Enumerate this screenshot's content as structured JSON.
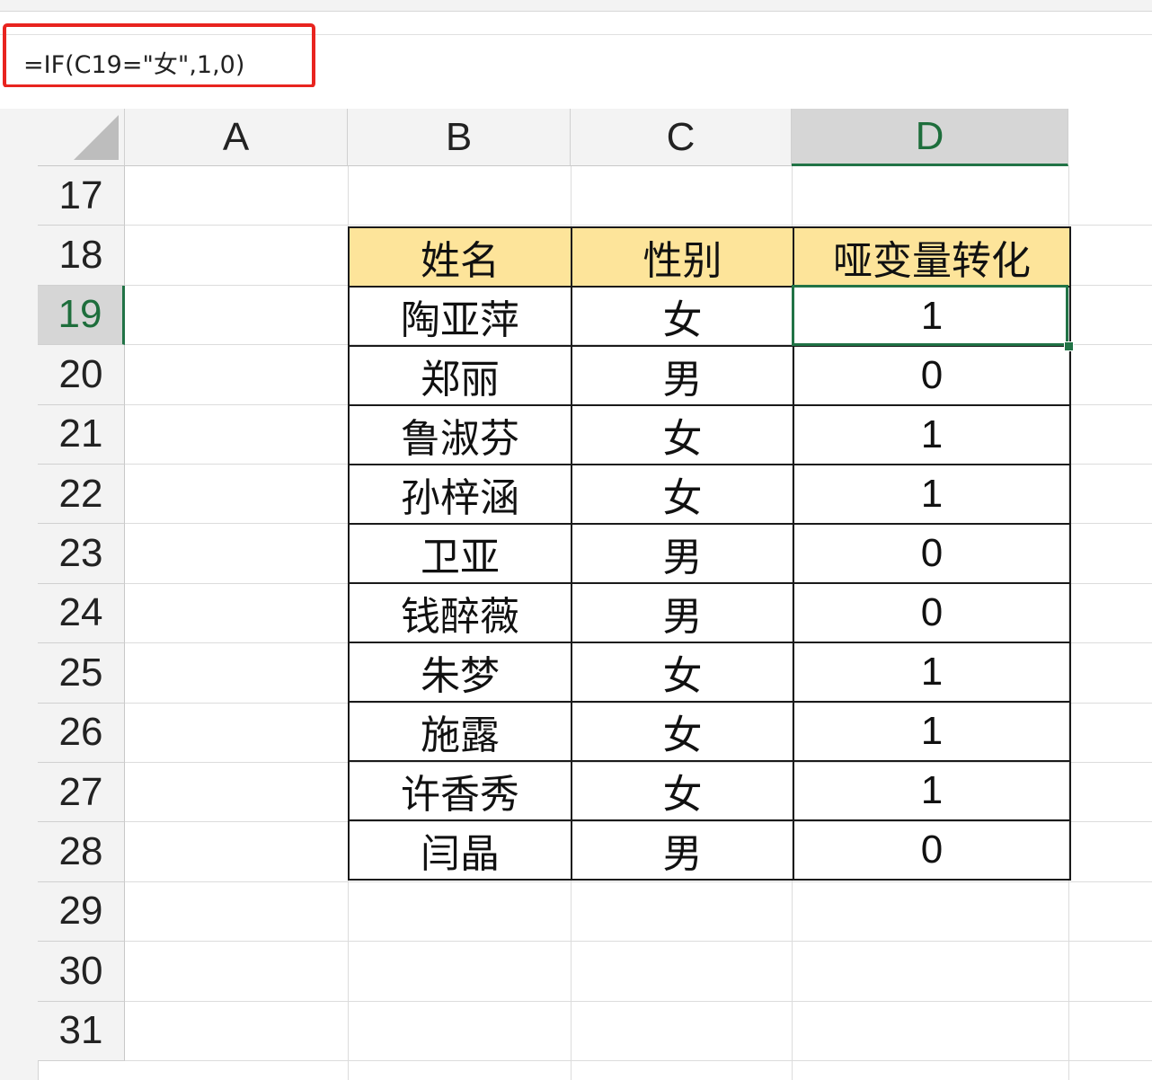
{
  "formula_bar": {
    "formula": "=IF(C19=\"女\",1,0)"
  },
  "columns": [
    "A",
    "B",
    "C",
    "D"
  ],
  "active_column": "D",
  "rows": [
    "17",
    "18",
    "19",
    "20",
    "21",
    "22",
    "23",
    "24",
    "25",
    "26",
    "27",
    "28",
    "29",
    "30",
    "31"
  ],
  "active_row": "19",
  "table": {
    "headers": [
      "姓名",
      "性别",
      "哑变量转化"
    ],
    "rows": [
      [
        "陶亚萍",
        "女",
        "1"
      ],
      [
        "郑丽",
        "男",
        "0"
      ],
      [
        "鲁淑芬",
        "女",
        "1"
      ],
      [
        "孙梓涵",
        "女",
        "1"
      ],
      [
        "卫亚",
        "男",
        "0"
      ],
      [
        "钱醉薇",
        "男",
        "0"
      ],
      [
        "朱梦",
        "女",
        "1"
      ],
      [
        "施露",
        "女",
        "1"
      ],
      [
        "许香秀",
        "女",
        "1"
      ],
      [
        "闫晶",
        "男",
        "0"
      ]
    ],
    "header_fill": "#fde49a"
  },
  "colors": {
    "highlight": "#e8241f",
    "selection": "#217346"
  }
}
